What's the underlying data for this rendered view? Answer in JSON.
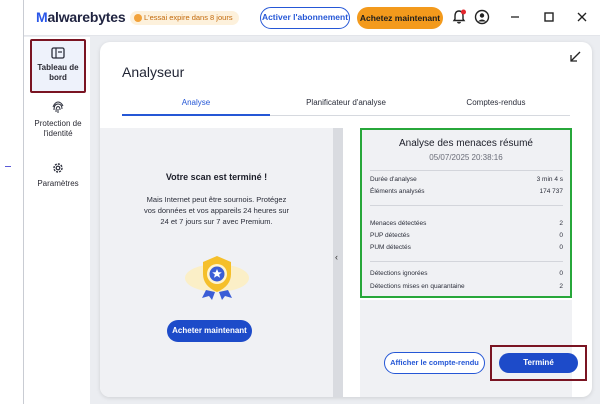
{
  "app": {
    "logo_prefix": "M",
    "logo_rest": "alwarebytes",
    "trial_badge": "L'essai expire dans 8 jours",
    "activate_label": "Activer l'abonnement",
    "buy_label": "Achetez maintenant",
    "icons": [
      "bell-alert-icon",
      "account-icon",
      "minimize-icon",
      "maximize-icon",
      "close-icon"
    ]
  },
  "sidebar": {
    "items": [
      {
        "label": "Tableau de bord",
        "icon": "dashboard-icon",
        "active": true
      },
      {
        "label": "Protection de l'identité",
        "icon": "fingerprint-icon",
        "active": false
      },
      {
        "label": "Paramètres",
        "icon": "gear-icon",
        "active": false
      }
    ]
  },
  "panel": {
    "title": "Analyseur",
    "tabs": [
      "Analyse",
      "Planificateur d'analyse",
      "Comptes-rendus"
    ],
    "active_tab": "Analyse"
  },
  "scan": {
    "title": "Votre scan est terminé !",
    "body": "Mais Internet peut être sournois. Protégez vos données et vos appareils 24 heures sur 24 et 7 jours sur 7 avec Premium.",
    "buy_label": "Acheter maintenant"
  },
  "summary": {
    "title": "Analyse des menaces résumé",
    "date": "05/07/2025 20:38:16",
    "rows": [
      {
        "label": "Durée d'analyse",
        "value": "3 min 4 s"
      },
      {
        "label": "Éléments analysés",
        "value": "174 737"
      },
      {
        "label": "Menaces détectées",
        "value": "2"
      },
      {
        "label": "PUP détectés",
        "value": "0"
      },
      {
        "label": "PUM détectés",
        "value": "0"
      },
      {
        "label": "Détections ignorées",
        "value": "0"
      },
      {
        "label": "Détections mises en quarantaine",
        "value": "2"
      }
    ],
    "report_label": "Afficher le compte-rendu",
    "done_label": "Terminé"
  },
  "colors": {
    "accent": "#2557d6",
    "buy": "#f39a1c",
    "highlight_red": "#7a1422",
    "highlight_green": "#27a73a"
  }
}
